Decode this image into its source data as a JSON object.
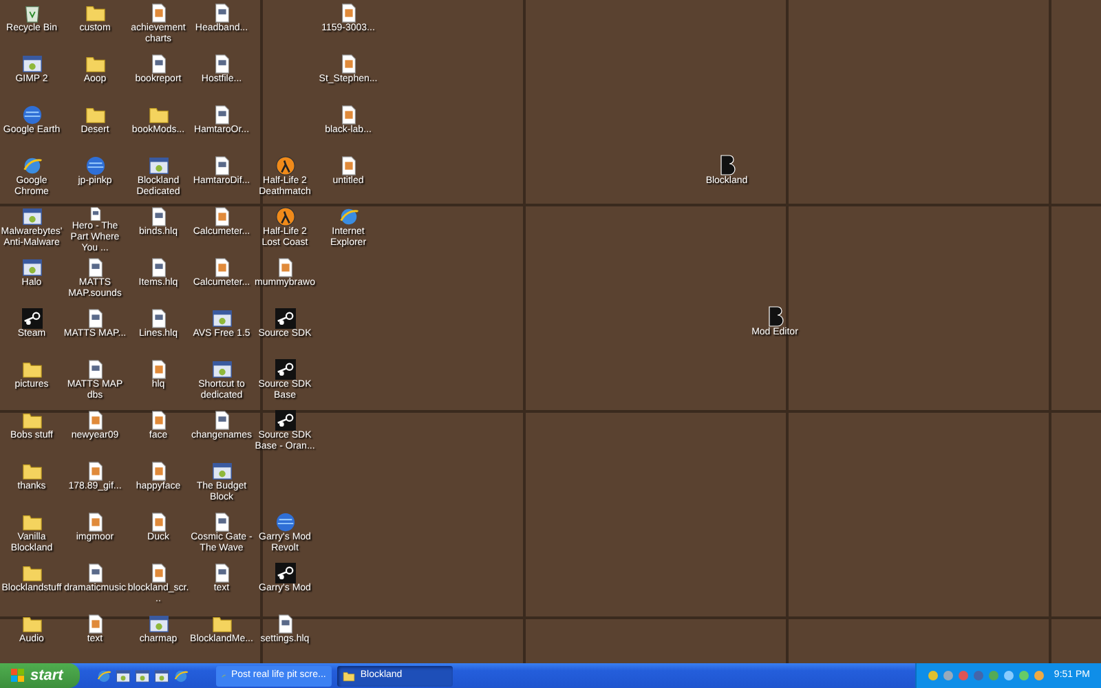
{
  "desktop": {
    "columns": [
      {
        "icons": [
          {
            "label": "Recycle Bin",
            "kind": "trash"
          },
          {
            "label": "GIMP 2",
            "kind": "app"
          },
          {
            "label": "Google Earth",
            "kind": "globe"
          },
          {
            "label": "Google Chrome",
            "kind": "browser"
          },
          {
            "label": "Malwarebytes' Anti-Malware",
            "kind": "app"
          },
          {
            "label": "Halo",
            "kind": "app"
          },
          {
            "label": "Steam",
            "kind": "steam"
          },
          {
            "label": "pictures",
            "kind": "folder"
          },
          {
            "label": "Bobs stuff",
            "kind": "folder"
          },
          {
            "label": "thanks",
            "kind": "folder"
          },
          {
            "label": "Vanilla Blockland",
            "kind": "folder"
          },
          {
            "label": "Blocklandstuff",
            "kind": "folder"
          },
          {
            "label": "Audio",
            "kind": "folder"
          }
        ]
      },
      {
        "icons": [
          {
            "label": "custom",
            "kind": "folder"
          },
          {
            "label": "Aoop",
            "kind": "folder"
          },
          {
            "label": "Desert",
            "kind": "folder"
          },
          {
            "label": "jp-pinkp",
            "kind": "globe"
          },
          {
            "label": "Hero - The Part Where You ...",
            "kind": "document"
          },
          {
            "label": "MATTS MAP.sounds",
            "kind": "document"
          },
          {
            "label": "MATTS MAP...",
            "kind": "document"
          },
          {
            "label": "MATTS MAP dbs",
            "kind": "document"
          },
          {
            "label": "newyear09",
            "kind": "image"
          },
          {
            "label": "178.89_gif...",
            "kind": "image"
          },
          {
            "label": "imgmoor",
            "kind": "image"
          },
          {
            "label": "dramaticmusic",
            "kind": "document"
          },
          {
            "label": "text",
            "kind": "image"
          }
        ]
      },
      {
        "icons": [
          {
            "label": "achievement charts",
            "kind": "image"
          },
          {
            "label": "bookreport",
            "kind": "document"
          },
          {
            "label": "bookMods...",
            "kind": "folder"
          },
          {
            "label": "Blockland Dedicated",
            "kind": "app"
          },
          {
            "label": "binds.hlq",
            "kind": "document"
          },
          {
            "label": "Items.hlq",
            "kind": "document"
          },
          {
            "label": "Lines.hlq",
            "kind": "document"
          },
          {
            "label": "hlq",
            "kind": "image"
          },
          {
            "label": "face",
            "kind": "image"
          },
          {
            "label": "happyface",
            "kind": "image"
          },
          {
            "label": "Duck",
            "kind": "image"
          },
          {
            "label": "blockland_scr...",
            "kind": "image"
          },
          {
            "label": "charmap",
            "kind": "app"
          }
        ]
      },
      {
        "icons": [
          {
            "label": "Headband...",
            "kind": "document"
          },
          {
            "label": "Hostfile...",
            "kind": "document"
          },
          {
            "label": "HamtaroOr...",
            "kind": "document"
          },
          {
            "label": "HamtaroDif...",
            "kind": "document"
          },
          {
            "label": "Calcumeter...",
            "kind": "image"
          },
          {
            "label": "Calcumeter...",
            "kind": "image"
          },
          {
            "label": "AVS Free 1.5",
            "kind": "app"
          },
          {
            "label": "Shortcut to dedicated",
            "kind": "app"
          },
          {
            "label": "changenames",
            "kind": "document"
          },
          {
            "label": "The Budget Block",
            "kind": "app"
          },
          {
            "label": "Cosmic Gate - The Wave",
            "kind": "document"
          },
          {
            "label": "text",
            "kind": "document"
          },
          {
            "label": "BlocklandMe...",
            "kind": "folder"
          }
        ]
      },
      {
        "icons": [
          {
            "kind": "blank"
          },
          {
            "kind": "blank"
          },
          {
            "kind": "blank"
          },
          {
            "label": "Half-Life 2 Deathmatch",
            "kind": "game"
          },
          {
            "label": "Half-Life 2 Lost Coast",
            "kind": "game"
          },
          {
            "label": "mummybrawo",
            "kind": "image"
          },
          {
            "label": "Source SDK",
            "kind": "steam"
          },
          {
            "label": "Source SDK Base",
            "kind": "steam"
          },
          {
            "label": "Source SDK Base - Oran...",
            "kind": "steam"
          },
          {
            "kind": "blank"
          },
          {
            "label": "Garry's Mod Revolt",
            "kind": "globe"
          },
          {
            "label": "Garry's Mod",
            "kind": "steam"
          },
          {
            "label": "settings.hlq",
            "kind": "document"
          }
        ]
      },
      {
        "icons": [
          {
            "label": "1159-3003...",
            "kind": "image"
          },
          {
            "label": "St_Stephen...",
            "kind": "image"
          },
          {
            "label": "black-lab...",
            "kind": "image"
          },
          {
            "label": "untitled",
            "kind": "image"
          },
          {
            "label": "Internet Explorer",
            "kind": "browser"
          }
        ]
      }
    ],
    "loose_icons": [
      {
        "label": "Blockland",
        "kind": "blockland"
      },
      {
        "label": "Mod Editor",
        "kind": "blockland"
      }
    ]
  },
  "taskbar": {
    "start": "start",
    "quick_launch": [
      {
        "kind": "browser"
      },
      {
        "kind": "app"
      },
      {
        "kind": "app"
      },
      {
        "kind": "app"
      },
      {
        "kind": "browser"
      }
    ],
    "tasks": [
      {
        "label": "Post real life pit scre...",
        "kind": "browser",
        "selected": false
      },
      {
        "label": "Blockland",
        "kind": "folder",
        "selected": true
      }
    ],
    "clock": "9:51 PM"
  }
}
